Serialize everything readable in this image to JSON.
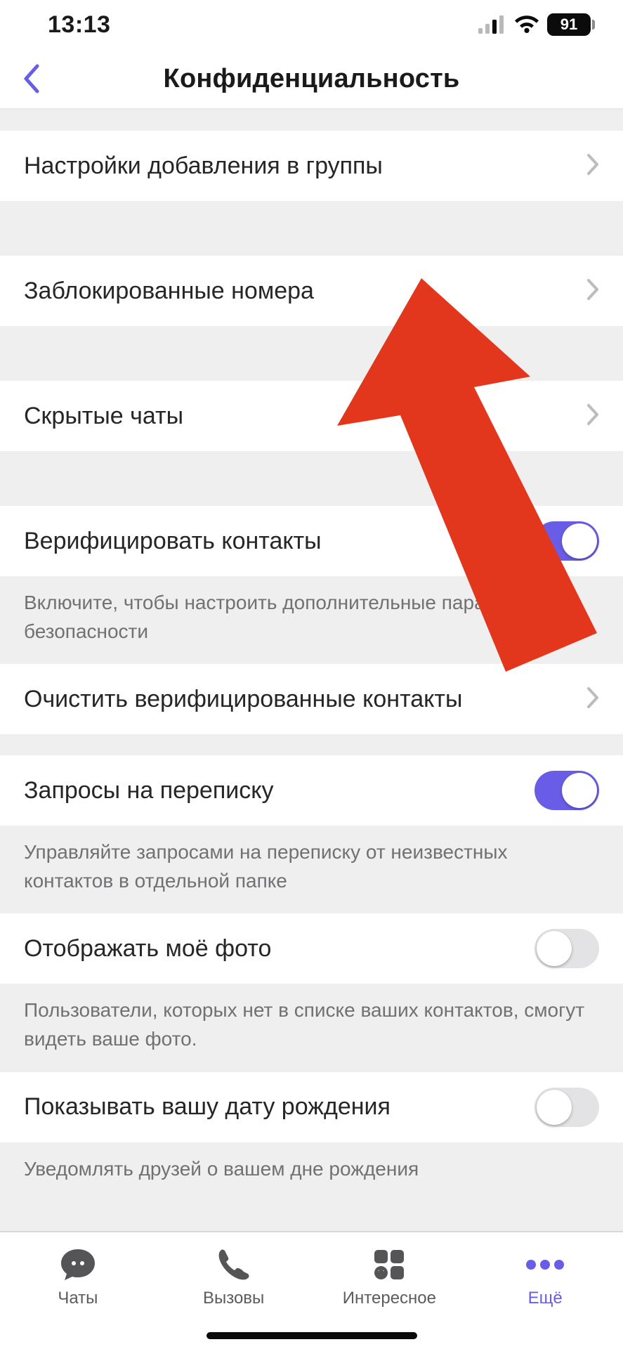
{
  "status": {
    "time": "13:13",
    "battery_pct": "91"
  },
  "nav": {
    "title": "Конфиденциальность"
  },
  "rows": {
    "group_add": {
      "label": "Настройки добавления в группы"
    },
    "blocked": {
      "label": "Заблокированные номера"
    },
    "hidden_chats": {
      "label": "Скрытые чаты"
    },
    "verify_contacts": {
      "label": "Верифицировать контакты",
      "desc": "Включите, чтобы настроить дополнительные параметры безопасности"
    },
    "clear_verified": {
      "label": "Очистить верифицированные контакты"
    },
    "msg_requests": {
      "label": "Запросы на переписку",
      "desc": "Управляйте запросами на переписку от неизвестных контактов в отдельной папке"
    },
    "show_photo": {
      "label": "Отображать моё фото",
      "desc": "Пользователи, которых нет в списке ваших контактов, смогут видеть ваше фото."
    },
    "show_birthday": {
      "label": "Показывать вашу дату рождения",
      "desc": "Уведомлять друзей о вашем дне рождения"
    }
  },
  "tabs": {
    "chats": "Чаты",
    "calls": "Вызовы",
    "explore": "Интересное",
    "more": "Ещё"
  },
  "colors": {
    "accent": "#695de7",
    "arrow": "#e2371d"
  }
}
